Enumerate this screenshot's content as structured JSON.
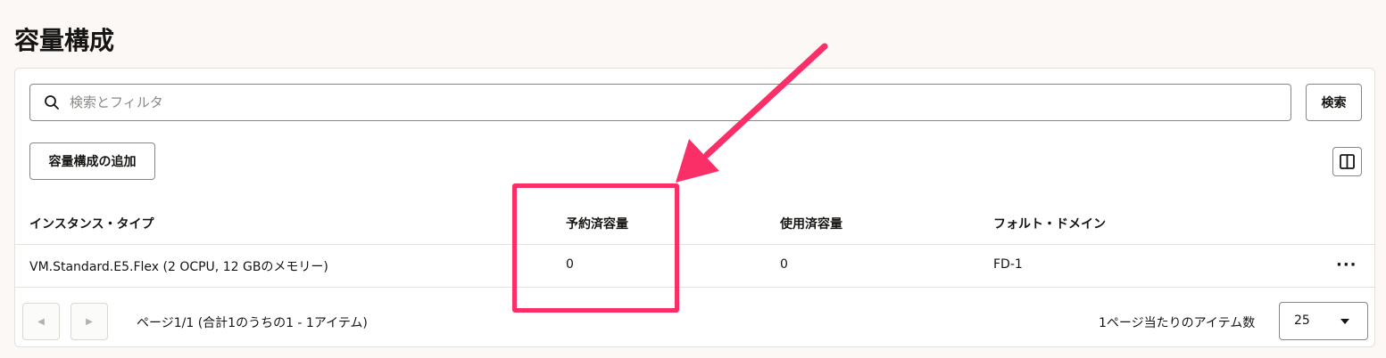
{
  "page": {
    "title": "容量構成"
  },
  "search": {
    "placeholder": "検索とフィルタ",
    "value": "",
    "button_label": "検索"
  },
  "toolbar": {
    "add_label": "容量構成の追加"
  },
  "table": {
    "headers": [
      "インスタンス・タイプ",
      "予約済容量",
      "使用済容量",
      "フォルト・ドメイン"
    ],
    "rows": [
      {
        "instance_type": "VM.Standard.E5.Flex (2 OCPU, 12 GBのメモリー)",
        "reserved": "0",
        "used": "0",
        "fault_domain": "FD-1"
      }
    ]
  },
  "pagination": {
    "summary": "ページ1/1 (合計1のうちの1 - 1アイテム)",
    "per_page_label": "1ページ当たりのアイテム数",
    "per_page_value": "25"
  },
  "annotation": {
    "highlight_color": "#fa2f67",
    "highlight_target": "予約済容量"
  }
}
